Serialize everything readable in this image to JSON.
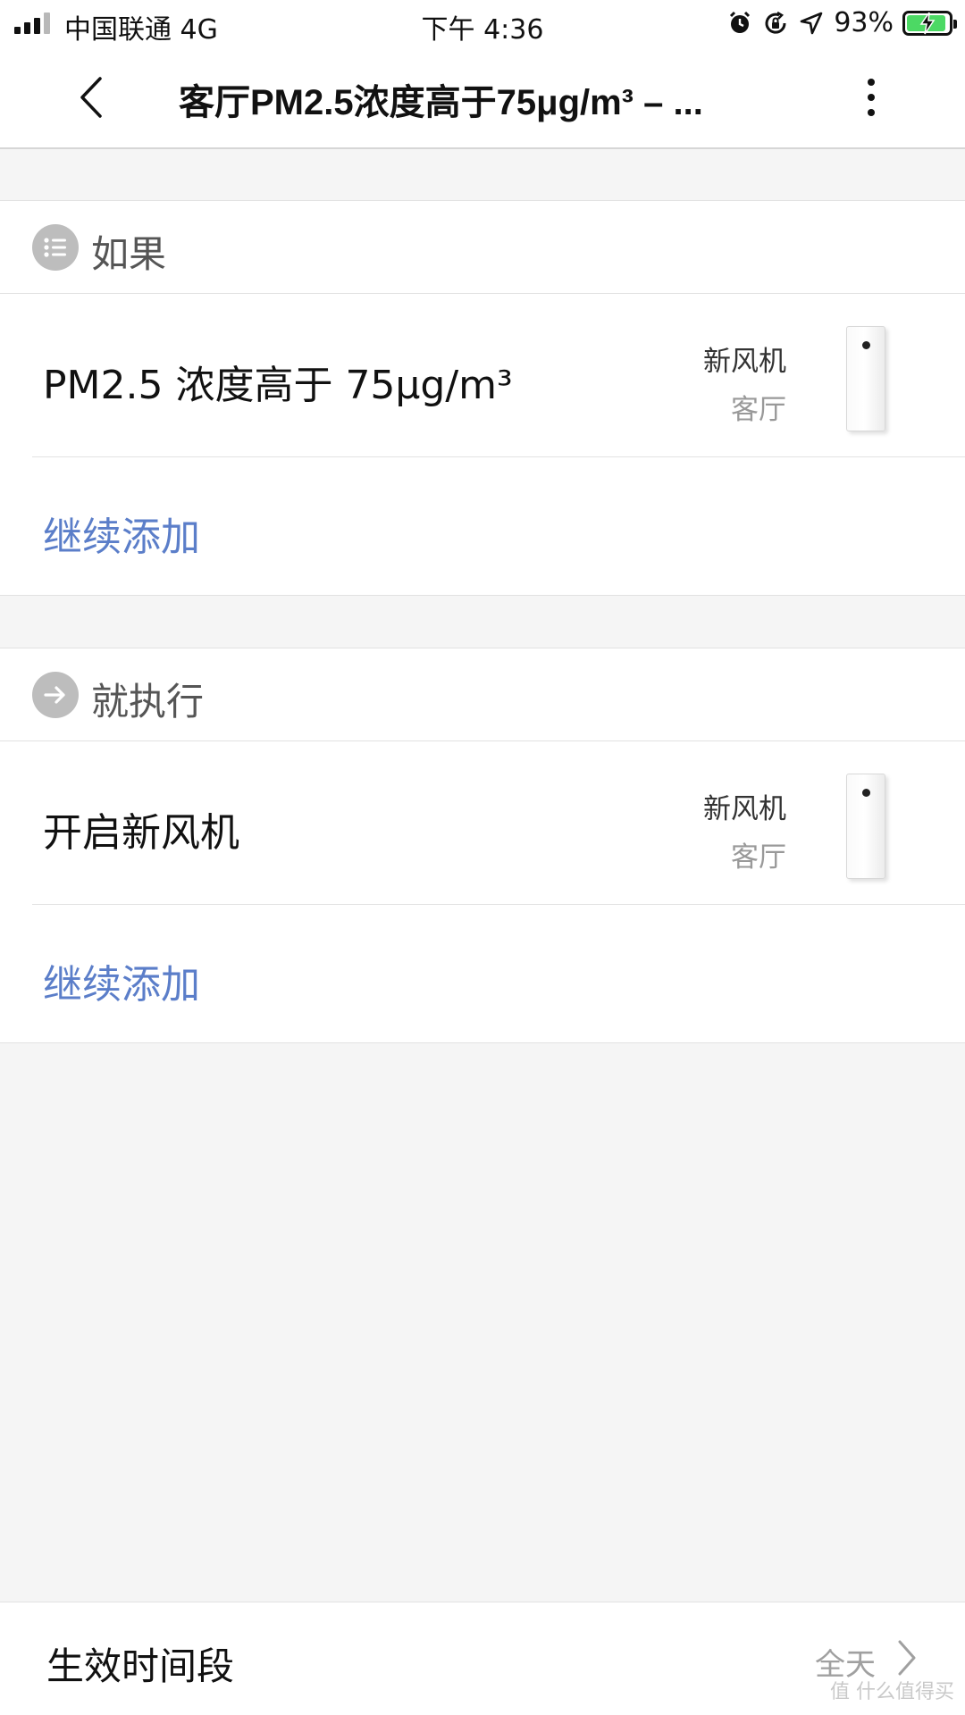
{
  "status_bar": {
    "carrier": "中国联通  4G",
    "time": "下午 4:36",
    "battery_percent": "93%",
    "icons": [
      "signal-icon",
      "alarm-icon",
      "rotation-lock-icon",
      "location-icon",
      "battery-charging-icon"
    ]
  },
  "header": {
    "title": "客厅PM2.5浓度高于75μg/m³ – ...",
    "back_icon": "chevron-left-icon",
    "more_icon": "more-vertical-icon"
  },
  "if_section": {
    "label": "如果",
    "icon": "list-icon",
    "condition": {
      "text": "PM2.5 浓度高于 75μg/m³",
      "device_name": "新风机",
      "room": "客厅"
    },
    "add_label": "继续添加"
  },
  "then_section": {
    "label": "就执行",
    "icon": "arrow-right-icon",
    "action": {
      "text": "开启新风机",
      "device_name": "新风机",
      "room": "客厅"
    },
    "add_label": "继续添加"
  },
  "effective_period": {
    "label": "生效时间段",
    "value": "全天"
  },
  "watermark": "值 什么值得买",
  "colors": {
    "link": "#5b7ec9",
    "section_icon_bg": "#bdbdbd",
    "battery_fill": "#4cd964"
  }
}
